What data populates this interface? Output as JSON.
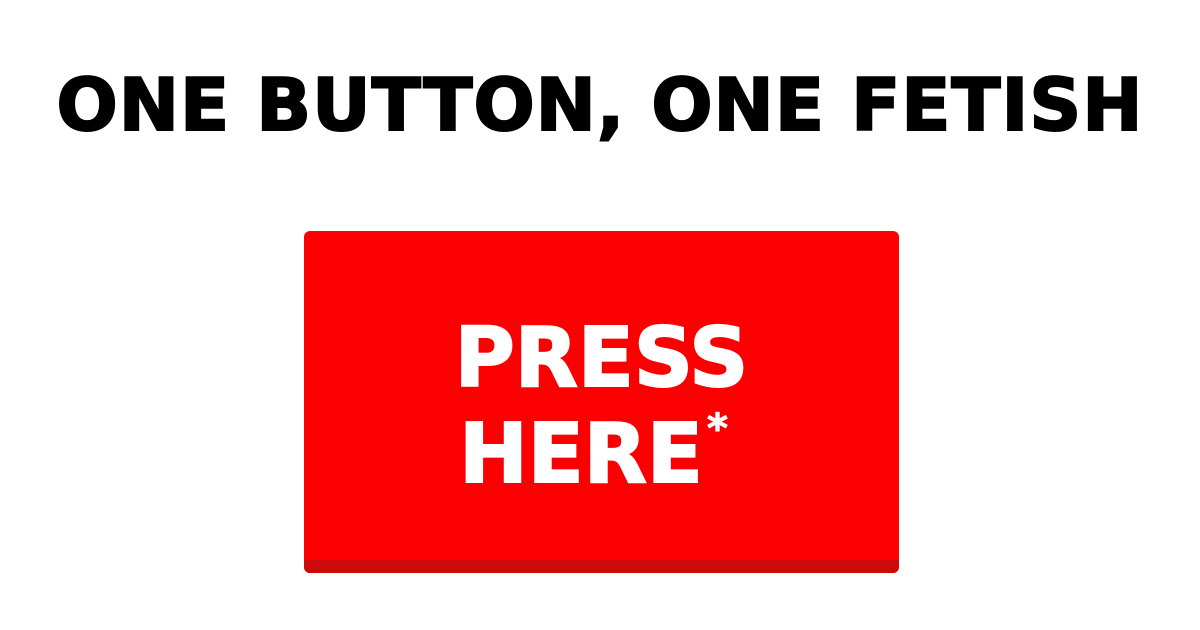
{
  "page": {
    "background_color": "#ffffff"
  },
  "headline": {
    "text": "ONE BUTTON, ONE FETISH",
    "color": "#000000"
  },
  "button": {
    "line1": "PRESS",
    "line2": "HERE",
    "footnote_marker": "*",
    "face_color": "#fa0000",
    "lip_color": "#cc0a0a",
    "text_color": "#ffffff"
  }
}
